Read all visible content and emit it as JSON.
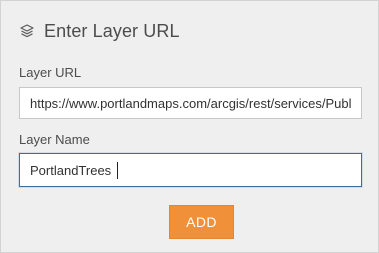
{
  "dialog": {
    "title": "Enter Layer URL",
    "title_icon": "layers-icon"
  },
  "layer_url": {
    "label": "Layer URL",
    "value": "https://www.portlandmaps.com/arcgis/rest/services/Public/"
  },
  "layer_name": {
    "label": "Layer Name",
    "value": "PortlandTrees"
  },
  "actions": {
    "add_label": "ADD",
    "add_color": "#f0913a"
  },
  "colors": {
    "panel_background": "#efefef",
    "focus_border": "#3f6e9b"
  }
}
